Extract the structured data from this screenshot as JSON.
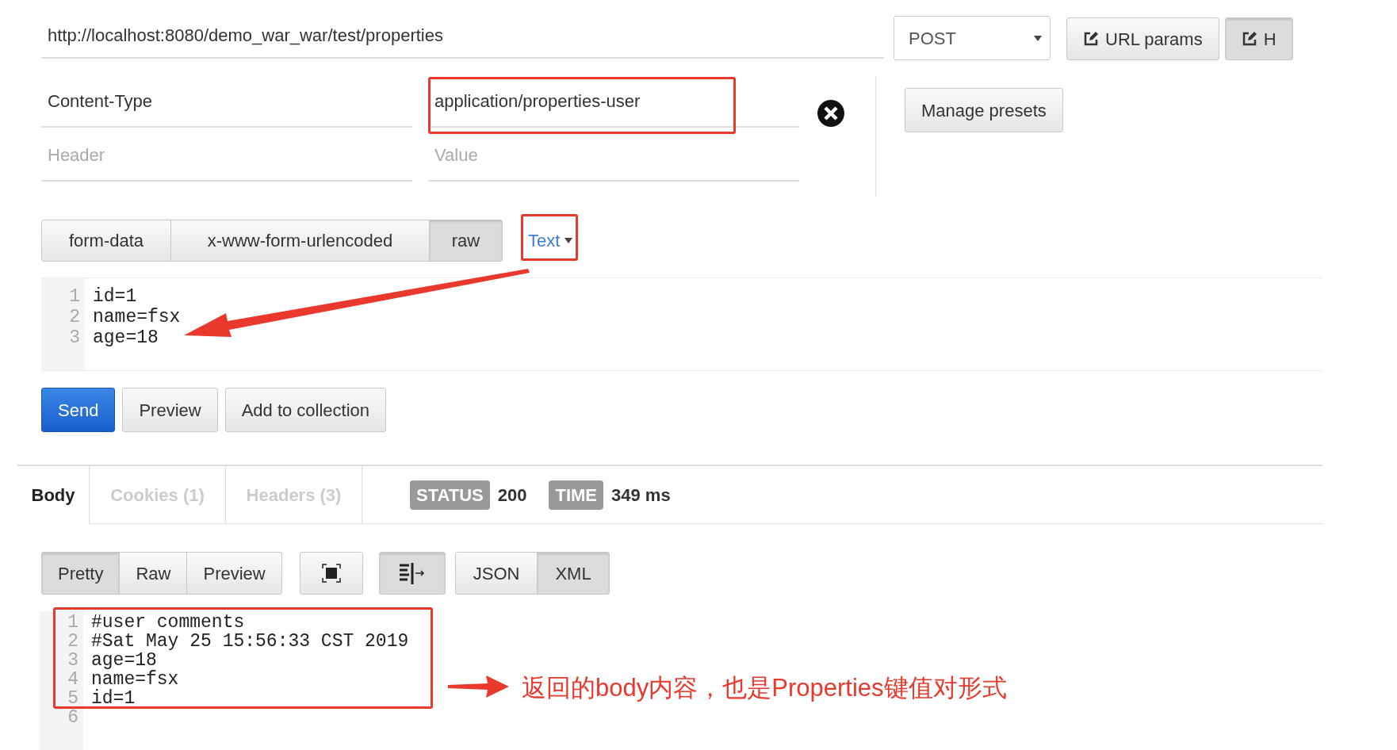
{
  "request": {
    "url": "http://localhost:8080/demo_war_war/test/properties",
    "method": "POST",
    "buttons": [
      "URL params",
      "H"
    ]
  },
  "headers": [
    {
      "key": "Content-Type",
      "value": "application/properties-user"
    }
  ],
  "new_header": {
    "key_placeholder": "Header",
    "value_placeholder": "Value"
  },
  "presets_button": "Manage presets",
  "body_modes": [
    {
      "label": "form-data",
      "selected": false
    },
    {
      "label": "x-www-form-urlencoded",
      "selected": false
    },
    {
      "label": "raw",
      "selected": true
    }
  ],
  "raw_type": "Text",
  "request_body": [
    {
      "number": "1",
      "text": "id=1"
    },
    {
      "number": "2",
      "text": "name=fsx"
    },
    {
      "number": "3",
      "text": "age=18"
    }
  ],
  "actions": [
    "Send",
    "Preview",
    "Add to collection"
  ],
  "response_tabs": [
    {
      "label": "Body",
      "selected": true
    },
    {
      "label": "Cookies (1)",
      "selected": false
    },
    {
      "label": "Headers (3)",
      "selected": false
    }
  ],
  "status": {
    "label": "STATUS",
    "value": "200"
  },
  "time": {
    "label": "TIME",
    "value": "349 ms"
  },
  "view_modes": [
    {
      "label": "Pretty",
      "selected": true
    },
    {
      "label": "Raw",
      "selected": false
    },
    {
      "label": "Preview",
      "selected": false
    }
  ],
  "wrap_lines": {
    "on": true
  },
  "formats": [
    {
      "label": "JSON",
      "selected": false
    },
    {
      "label": "XML",
      "selected": true
    }
  ],
  "response_body": [
    {
      "number": "1",
      "text": "#user comments"
    },
    {
      "number": "2",
      "text": "#Sat May 25 15:56:33 CST 2019"
    },
    {
      "number": "3",
      "text": "age=18"
    },
    {
      "number": "4",
      "text": "name=fsx"
    },
    {
      "number": "5",
      "text": "id=1"
    },
    {
      "number": "6"
    }
  ],
  "annotation": {
    "note": "返回的body内容，也是Properties键值对形式"
  }
}
